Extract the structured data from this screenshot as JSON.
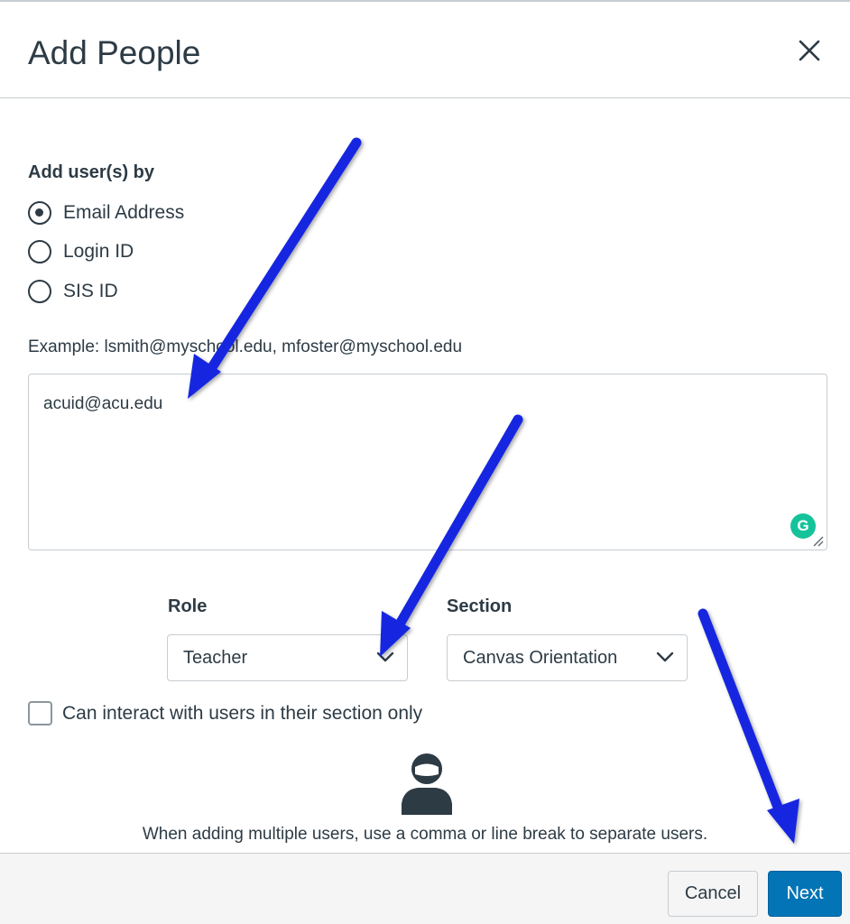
{
  "dialog": {
    "title": "Add People",
    "close_icon": "close-icon"
  },
  "add_by": {
    "label": "Add user(s) by",
    "options": [
      {
        "label": "Email Address",
        "checked": true
      },
      {
        "label": "Login ID",
        "checked": false
      },
      {
        "label": "SIS ID",
        "checked": false
      }
    ]
  },
  "example_text": "Example: lsmith@myschool.edu, mfoster@myschool.edu",
  "users_input": {
    "value": "acuid@acu.edu",
    "grammarly_badge": "G"
  },
  "role": {
    "label": "Role",
    "selected": "Teacher"
  },
  "section": {
    "label": "Section",
    "selected": "Canvas Orientation"
  },
  "section_only_checkbox": {
    "label": "Can interact with users in their section only",
    "checked": false
  },
  "hint": "When adding multiple users, use a comma or line break to separate users.",
  "footer": {
    "cancel_label": "Cancel",
    "next_label": "Next"
  },
  "colors": {
    "primary": "#0374b5",
    "text": "#2d3b45",
    "border": "#c7cdd1",
    "annotation_arrow": "#1428e0",
    "grammarly": "#15c39a"
  }
}
